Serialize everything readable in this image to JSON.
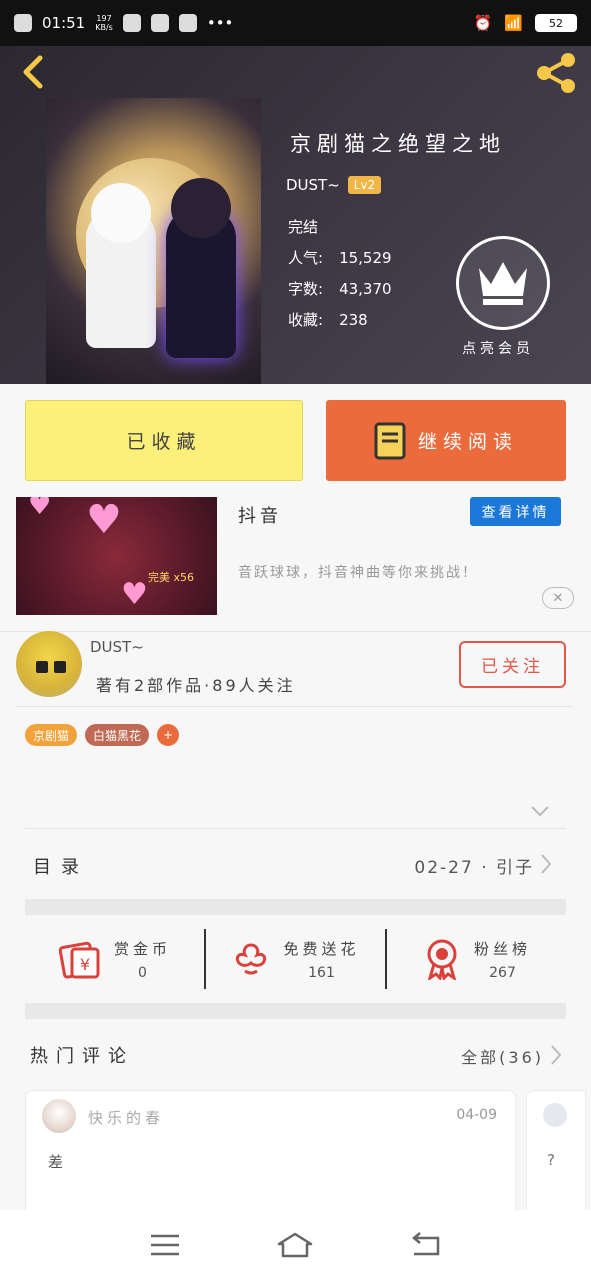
{
  "status_bar": {
    "time": "01:51",
    "net_speed": "197\nKB/s",
    "battery": "52"
  },
  "book": {
    "title": "京剧猫之绝望之地",
    "author": "DUST~",
    "level": "Lv2",
    "status": "完结",
    "stats": [
      {
        "label": "人气:",
        "value": "15,529"
      },
      {
        "label": "字数:",
        "value": "43,370"
      },
      {
        "label": "收藏:",
        "value": "238"
      }
    ],
    "crown_label": "点亮会员"
  },
  "actions": {
    "favorite_label": "已收藏",
    "read_label": "继续阅读"
  },
  "promo": {
    "title": "抖音",
    "button_label": "查看详情",
    "description": "音跃球球，抖音神曲等你来挑战！",
    "badge": "完美 x56"
  },
  "author_card": {
    "name": "DUST~",
    "info": "著有2部作品·89人关注",
    "follow_label": "已关注"
  },
  "tags": [
    "京剧猫",
    "白猫黑花",
    "+"
  ],
  "toc": {
    "title": "目录",
    "latest": "02-27 · 引子"
  },
  "rewards": [
    {
      "label": "赏金币",
      "value": "0"
    },
    {
      "label": "免费送花",
      "value": "161"
    },
    {
      "label": "粉丝榜",
      "value": "267"
    }
  ],
  "comments": {
    "title": "热门评论",
    "all_label": "全部(36)",
    "items": [
      {
        "user": "快乐的春",
        "date": "04-09",
        "text": "差"
      },
      {
        "user": "",
        "date": "",
        "text": "?"
      }
    ]
  },
  "colors": {
    "accent_orange": "#ec6b3c",
    "favorite_yellow": "#fbf07a",
    "follow_red": "#e0574c",
    "promo_blue": "#1b78d8"
  }
}
